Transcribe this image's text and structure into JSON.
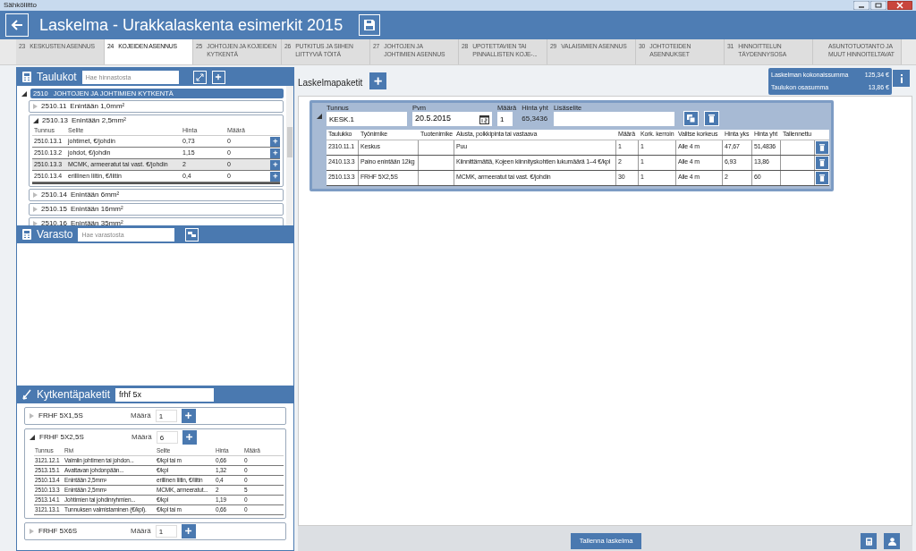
{
  "window": {
    "title": "Sähköliitto"
  },
  "header": {
    "title": "Laskelma - Urakkalaskenta esimerkit 2015"
  },
  "tabs": [
    {
      "number": "23",
      "label": "KESKUSTEN ASENNUS",
      "selected": false
    },
    {
      "number": "24",
      "label": "KOJEIDEN ASENNUS",
      "selected": true
    },
    {
      "number": "25",
      "label": "JOHTOJEN JA KOJEIDEN KYTKENTÄ",
      "selected": false
    },
    {
      "number": "26",
      "label": "PUTKITUS JA SIIHEN LIITTYVIÄ TÖITÄ",
      "selected": false
    },
    {
      "number": "27",
      "label": "JOHTOJEN JA JOHTIMIEN ASENNUS",
      "selected": false
    },
    {
      "number": "28",
      "label": "UPOTETTAVIEN TAI PINNALLISTEN KOJE-...",
      "selected": false
    },
    {
      "number": "29",
      "label": "VALAISIMIEN ASENNUS",
      "selected": false
    },
    {
      "number": "30",
      "label": "JOHTOTEIDEN ASENNUKSET",
      "selected": false
    },
    {
      "number": "31",
      "label": "HINNOITTELUN TÄYDENNYSOSA",
      "selected": false
    },
    {
      "label": "ASUNTOTUOTANTO JA MUUT HINNOITELTAVAT",
      "selected": false
    }
  ],
  "taulukot": {
    "title": "Taulukot",
    "search_placeholder": "Hae hinnastosta",
    "tree": {
      "code": "2510",
      "label": "JOHTOJEN JA JOHTIMIEN KYTKENTÄ",
      "expanded": true,
      "children": [
        {
          "code": "2510.11",
          "label": "Enintään 1,0mm²",
          "expanded": false
        },
        {
          "code": "2510.13",
          "label": "Enintään 2,5mm²",
          "expanded": true,
          "columns": [
            "Tunnus",
            "Selite",
            "Hinta",
            "Määrä"
          ],
          "rows": [
            {
              "cells": [
                "2510.13.1",
                "johtimet, €/johdin",
                "0,73",
                "0"
              ],
              "selected": false
            },
            {
              "cells": [
                "2510.13.2",
                "johdot, €/johdin",
                "1,15",
                "0"
              ],
              "selected": false
            },
            {
              "cells": [
                "2510.13.3",
                "MCMK, armeeratut tai vast. €/johdin",
                "2",
                "0"
              ],
              "selected": true
            },
            {
              "cells": [
                "2510.13.4",
                "erillinen liitin, €/liitin",
                "0,4",
                "0"
              ],
              "selected": false
            }
          ]
        },
        {
          "code": "2510.14",
          "label": "Enintään 6mm²",
          "expanded": false
        },
        {
          "code": "2510.15",
          "label": "Enintään 16mm²",
          "expanded": false
        },
        {
          "code": "2510.16",
          "label": "Enintään 35mm²",
          "expanded": false
        }
      ]
    }
  },
  "varasto": {
    "title": "Varasto",
    "search_placeholder": "Hae varastosta"
  },
  "kytkentapaketit": {
    "title": "Kytkentäpaketit",
    "search_value": "frhf 5x",
    "packages": [
      {
        "name": "FRHF 5X1,5S",
        "quantity_label": "Määrä",
        "quantity": "1",
        "expanded": false
      },
      {
        "name": "FRHF 5X2,5S",
        "quantity_label": "Määrä",
        "quantity": "6",
        "expanded": true,
        "columns": [
          "Tunnus",
          "Rivi",
          "Selite",
          "Hinta",
          "Määrä"
        ],
        "rows": [
          [
            "3121.12.1",
            "Valmiin johtimen tai johdon...",
            "€/kpl tai m",
            "0,66",
            "0"
          ],
          [
            "2513.15.1",
            "Avattavan johdonpään...",
            "€/kpl",
            "1,32",
            "0"
          ],
          [
            "2510.13.4",
            "Enintään 2,5mm²",
            "erillinen liitin, €/liitin",
            "0,4",
            "0"
          ],
          [
            "2510.13.3",
            "Enintään 2,5mm²",
            "MCMK, armeeratut...",
            "2",
            "5"
          ],
          [
            "2513.14.1",
            "Johtimien tai johdinryhmien...",
            "€/kpl",
            "1,19",
            "0"
          ],
          [
            "3121.13.1",
            "Tunnuksen valmistaminen (€/kpl).",
            "€/kpl tai m",
            "0,66",
            "0"
          ]
        ]
      },
      {
        "name": "FRHF 5X6S",
        "quantity_label": "Määrä",
        "quantity": "1",
        "expanded": false
      }
    ]
  },
  "laskelmapaketit": {
    "title": "Laskelmapaketit",
    "totals": [
      {
        "label": "Laskelman kokonaissumma",
        "value": "125,34 €"
      },
      {
        "label": "Taulukon osasumma",
        "value": "13,86 €"
      }
    ],
    "packages": [
      {
        "expanded": true,
        "fields": [
          {
            "label": "Tunnus",
            "value": "KESK.1",
            "kind": "text"
          },
          {
            "label": "Pvm",
            "value": "20.5.2015",
            "kind": "date"
          },
          {
            "label": "Määrä",
            "value": "1",
            "kind": "small"
          },
          {
            "label": "Hinta yht",
            "value": "65,3436",
            "kind": "readout"
          },
          {
            "label": "Lisäselite",
            "kind": "wide"
          }
        ],
        "columns": [
          "Taulukko",
          "Työnimike",
          "Tuotenimike",
          "Alusta, polkkipinta tai vastaava",
          "Määrä",
          "Kork. kerroin",
          "Valitse korkeus",
          "Hinta yks",
          "Hinta yht",
          "Tallennettu"
        ],
        "rows": [
          [
            "2310.11.1",
            "Keskus",
            "",
            "Puu",
            "1",
            "1",
            "Alle 4 m",
            "47,67",
            "51,4836",
            ""
          ],
          [
            "2410.13.3",
            "Paino enintään 12kg",
            "",
            "Kiinnittämättä, Kojeen kiinnityskohtien lukumäärä 1–4 €/kpl",
            "2",
            "1",
            "Alle 4 m",
            "6,93",
            "13,86",
            ""
          ],
          [
            "2510.13.3",
            "FRHF 5X2,5S",
            "",
            "MCMK, armeeratut tai vast. €/johdin",
            "30",
            "1",
            "Alle 4 m",
            "2",
            "60",
            ""
          ]
        ]
      }
    ]
  },
  "save_button": "Tallenna laskelma"
}
